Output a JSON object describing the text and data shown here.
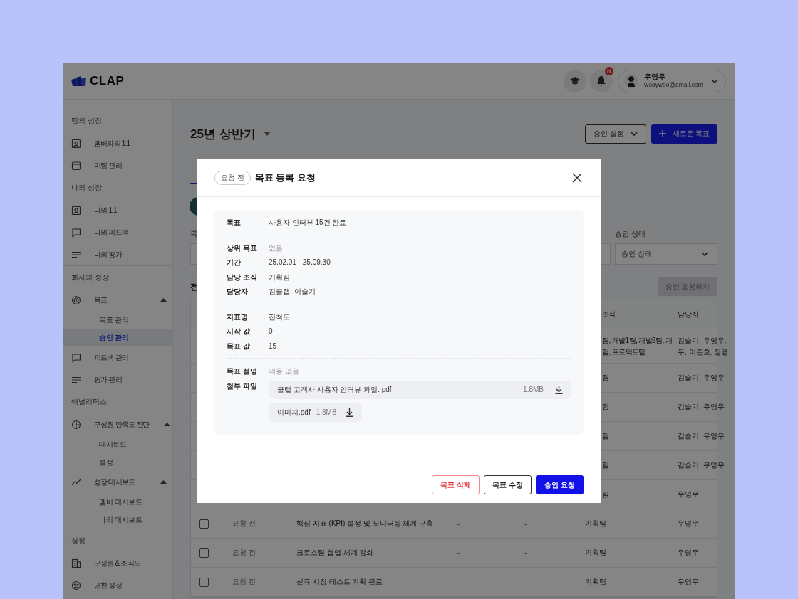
{
  "app": {
    "logo": "CLAP",
    "notification_badge": "N",
    "user": {
      "name": "우영우",
      "email": "wooywoo@email.com"
    }
  },
  "sidebar": {
    "sections": [
      {
        "title": "팀의 성장",
        "separated": false,
        "items": [
          {
            "label": "멤버와의 1:1",
            "kind": "person-card",
            "selected": false
          },
          {
            "label": "미팅 관리",
            "kind": "calendar",
            "selected": false
          }
        ]
      },
      {
        "title": "나의 성장",
        "separated": false,
        "items": [
          {
            "label": "나의 1:1",
            "kind": "person-card",
            "selected": false
          },
          {
            "label": "나의 피드백",
            "kind": "chat",
            "selected": false
          },
          {
            "label": "나의 평가",
            "kind": "lines",
            "selected": false
          }
        ]
      },
      {
        "title": "회사의 성장",
        "separated": true,
        "items": [
          {
            "label": "목표",
            "kind": "target",
            "selected": false,
            "expanded": true,
            "children": [
              {
                "label": "목표 관리",
                "selected": false
              },
              {
                "label": "승인 관리",
                "selected": true
              }
            ]
          },
          {
            "label": "피드백 관리",
            "kind": "chat",
            "selected": false
          },
          {
            "label": "평가 관리",
            "kind": "lines",
            "selected": false
          }
        ]
      },
      {
        "title": "애널리틱스",
        "separated": false,
        "items": [
          {
            "label": "구성원 만족도 진단",
            "kind": "pie",
            "selected": false,
            "expanded": true,
            "children": [
              {
                "label": "대시보드",
                "selected": false
              },
              {
                "label": "설정",
                "selected": false
              }
            ]
          },
          {
            "label": "성장 대시보드",
            "kind": "trend",
            "selected": false,
            "expanded": true,
            "children": [
              {
                "label": "멤버 대시보드",
                "selected": false
              },
              {
                "label": "나의 대시보드",
                "selected": false
              }
            ]
          }
        ]
      },
      {
        "title": "설정",
        "separated": true,
        "items": [
          {
            "label": "구성원 & 조직도",
            "kind": "building",
            "selected": false
          },
          {
            "label": "권한 설정",
            "kind": "people",
            "selected": false
          }
        ]
      }
    ]
  },
  "page": {
    "title": "25년 상반기",
    "buttons": [
      {
        "label": "승인 설정",
        "kind": "dropdown"
      },
      {
        "label": "새로운 목표",
        "kind": "primary"
      }
    ],
    "filters": [
      {
        "label": "목",
        "kind": "text"
      },
      {
        "label": "승인 상태",
        "kind": "select",
        "placeholder": "승인 상태"
      }
    ],
    "section_heading": "전",
    "request_button": {
      "label": "승인 요청하기",
      "disabled": true
    },
    "table": {
      "headers": {
        "org": "조직",
        "owner": "담당자"
      },
      "rows": [
        {
          "kind": "covered",
          "org": "팀, 개발1팀, 개발2팀, 개\n팀, 프로덕트팀",
          "owner": "김슬기, 우영우,\n우, 이준호, 정명"
        },
        {
          "kind": "covered",
          "org": "팀",
          "owner": "김슬기, 우영우"
        },
        {
          "kind": "covered",
          "org": "팀",
          "owner": "김슬기, 우영우"
        },
        {
          "kind": "covered",
          "org": "팀",
          "owner": "김슬기, 우영우"
        },
        {
          "kind": "covered",
          "org": "팀",
          "owner": "김슬기, 우영우"
        },
        {
          "kind": "covered",
          "org": "팀",
          "owner": "우영우"
        },
        {
          "kind": "full",
          "checked": false,
          "status": "요청 전",
          "title": "핵심 지표 (KPI) 설정 및 모니터링 체계 구축",
          "column_4": "-",
          "column_5": "-",
          "org": "기획팀",
          "owner": "우영우"
        },
        {
          "kind": "full",
          "checked": false,
          "status": "요청 전",
          "title": "크로스팀 협업 체계 강화",
          "column_4": "-",
          "column_5": "-",
          "org": "기획팀",
          "owner": "우영우"
        },
        {
          "kind": "full",
          "checked": false,
          "status": "요청 전",
          "title": "신규 시장 테스트 기획 완료",
          "column_4": "-",
          "column_5": "-",
          "org": "기획팀",
          "owner": "우영우"
        }
      ]
    }
  },
  "modal": {
    "status_badge": "요청 전",
    "title": "목표 등록 요청",
    "groups": [
      [
        {
          "label": "목표",
          "kind": "text",
          "value": "사용자 인터뷰 15건 완료",
          "empty": false
        }
      ],
      [
        {
          "label": "상위 목표",
          "kind": "text",
          "value": "없음",
          "empty": true
        },
        {
          "label": "기간",
          "kind": "text",
          "value": "25.02.01 - 25.09.30",
          "empty": false
        },
        {
          "label": "담당 조직",
          "kind": "text",
          "value": "기획팀",
          "empty": false
        },
        {
          "label": "담당자",
          "kind": "text",
          "value": "김클랩, 이슬기",
          "empty": false
        }
      ],
      [
        {
          "label": "지표명",
          "kind": "text",
          "value": "진척도",
          "empty": false
        },
        {
          "label": "시작 값",
          "kind": "text",
          "value": "0",
          "empty": false
        },
        {
          "label": "목표 값",
          "kind": "text",
          "value": "15",
          "empty": false
        }
      ],
      [
        {
          "label": "목표 설명",
          "kind": "text",
          "value": "내용 없음",
          "empty": true
        },
        {
          "label": "첨부 파일",
          "kind": "files",
          "files": [
            {
              "name": "클랩 고객사 사용자 인터뷰 파일. pdf",
              "size": "1.8MB",
              "kind": "row"
            },
            {
              "name": "이미지.pdf",
              "size": "1.8MB",
              "kind": "chip"
            }
          ]
        }
      ]
    ],
    "actions": [
      {
        "label": "목표 삭제",
        "kind": "danger"
      },
      {
        "label": "목표 수정",
        "kind": "outline"
      },
      {
        "label": "승인 요청",
        "kind": "primary"
      }
    ]
  }
}
